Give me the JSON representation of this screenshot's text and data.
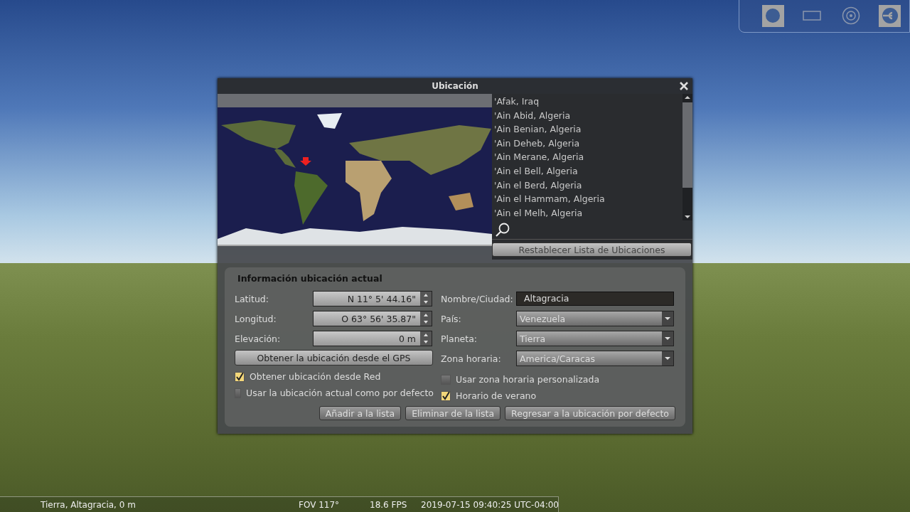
{
  "toolbar": [
    {
      "kind": "circle",
      "on": true
    },
    {
      "kind": "rect",
      "on": false
    },
    {
      "kind": "target",
      "on": false
    },
    {
      "kind": "wrench",
      "on": true
    }
  ],
  "window": {
    "title": "Ubicación"
  },
  "locations": [
    {
      "name": "'Afak, Iraq",
      "selected": false
    },
    {
      "name": "'Ain Abid, Algeria",
      "selected": false
    },
    {
      "name": "'Ain Benian, Algeria",
      "selected": false
    },
    {
      "name": "'Ain Deheb, Algeria",
      "selected": false
    },
    {
      "name": "'Ain Merane, Algeria",
      "selected": false
    },
    {
      "name": "'Ain el Bell, Algeria",
      "selected": false
    },
    {
      "name": "'Ain el Berd, Algeria",
      "selected": false
    },
    {
      "name": "'Ain el Hammam, Algeria",
      "selected": false
    },
    {
      "name": "'Ain el Melh, Algeria",
      "selected": false
    }
  ],
  "reset_button": "Restablecer Lista de Ubicaciones",
  "info": {
    "title": "Información ubicación actual",
    "coords": [
      {
        "label": "Latitud:",
        "value": "N 11° 5' 44.16\""
      },
      {
        "label": "Longitud:",
        "value": "O 63° 56' 35.87\""
      },
      {
        "label": "Elevación:",
        "value": "0 m"
      }
    ],
    "gps_button": "Obtener la ubicación desde el GPS",
    "left_checks": [
      {
        "label": "Obtener ubicación desde Red",
        "checked": true
      },
      {
        "label": "Usar la ubicación actual como por defecto",
        "checked": false
      }
    ],
    "name": {
      "label": "Nombre/Ciudad:",
      "value": "Altagracia"
    },
    "dropdowns": [
      {
        "label": "País:",
        "value": "Venezuela"
      },
      {
        "label": "Planeta:",
        "value": "Tierra"
      },
      {
        "label": "Zona horaria:",
        "value": "America/Caracas"
      }
    ],
    "right_checks": [
      {
        "label": "Usar zona horaria personalizada",
        "checked": false
      },
      {
        "label": "Horario de verano",
        "checked": true
      }
    ],
    "buttons": [
      "Añadir a la lista",
      "Eliminar de la lista",
      "Regresar a la ubicación por defecto"
    ]
  },
  "status_bar": {
    "location": "Tierra, Altagracia, 0 m",
    "fov": "FOV 117°",
    "fps": "18.6 FPS",
    "datetime": "2019-07-15 09:40:25 UTC-04:00"
  }
}
